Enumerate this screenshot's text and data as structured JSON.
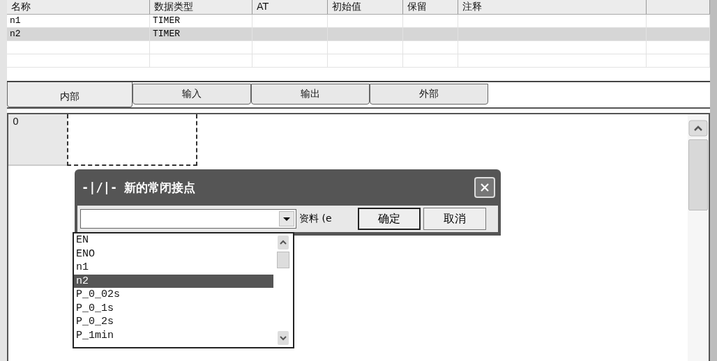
{
  "variable_table": {
    "columns": [
      "名称",
      "数据类型",
      "AT",
      "初始值",
      "保留",
      "注释",
      ""
    ],
    "rows": [
      {
        "cells": [
          "n1",
          "TIMER",
          "",
          "",
          "",
          "",
          ""
        ],
        "selected": false
      },
      {
        "cells": [
          "n2",
          "TIMER",
          "",
          "",
          "",
          "",
          ""
        ],
        "selected": true
      },
      {
        "cells": [
          "",
          "",
          "",
          "",
          "",
          "",
          ""
        ],
        "selected": false
      },
      {
        "cells": [
          "",
          "",
          "",
          "",
          "",
          "",
          ""
        ],
        "selected": false
      }
    ]
  },
  "tabs": [
    {
      "label": "内部",
      "selected": true
    },
    {
      "label": "输入",
      "selected": false
    },
    {
      "label": "输出",
      "selected": false
    },
    {
      "label": "外部",
      "selected": false
    }
  ],
  "ladder": {
    "rung_number": "0"
  },
  "dialog": {
    "symbol": "-|/|-",
    "title": "新的常闭接点",
    "detail_label": "资料 (e",
    "ok": "确定",
    "cancel": "取消",
    "dropdown_items": [
      {
        "label": "EN",
        "selected": false
      },
      {
        "label": "ENO",
        "selected": false
      },
      {
        "label": "n1",
        "selected": false
      },
      {
        "label": "n2",
        "selected": true
      },
      {
        "label": "P_0_02s",
        "selected": false
      },
      {
        "label": "P_0_1s",
        "selected": false
      },
      {
        "label": "P_0_2s",
        "selected": false
      },
      {
        "label": "P_1min",
        "selected": false
      }
    ]
  }
}
